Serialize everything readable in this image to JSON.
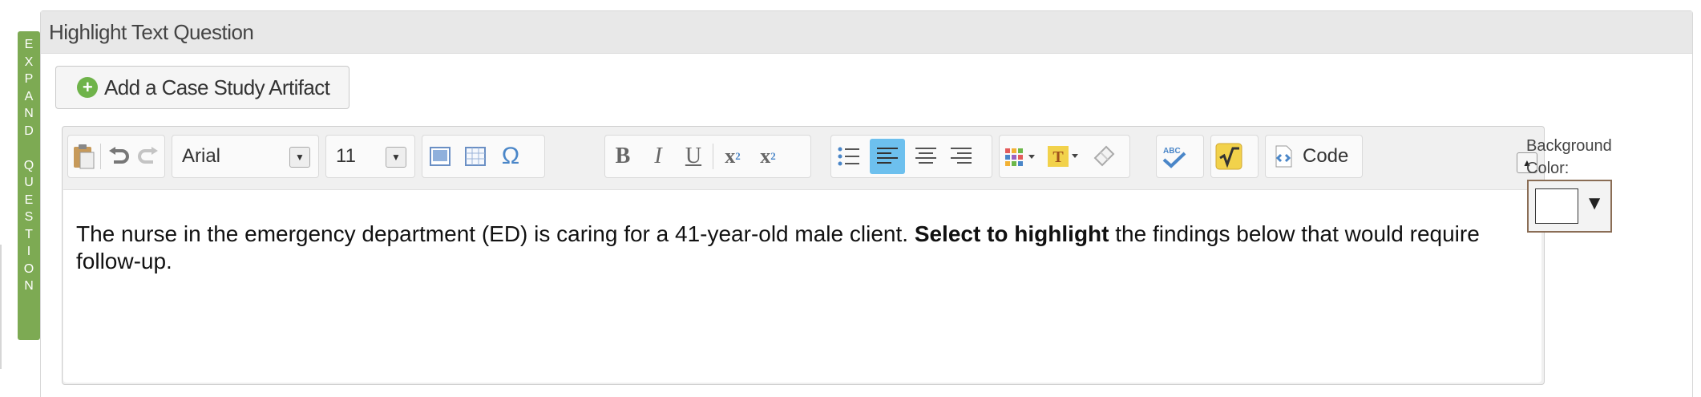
{
  "expand_tab": {
    "letters": [
      "E",
      "X",
      "P",
      "A",
      "N",
      "D",
      "",
      "Q",
      "U",
      "E",
      "S",
      "T",
      "I",
      "O",
      "N"
    ]
  },
  "panel": {
    "title": "Highlight Text Question"
  },
  "artifact_button": {
    "label": "Add a Case Study Artifact"
  },
  "toolbar": {
    "font_name": "Arial",
    "font_size": "11",
    "code_label": "Code"
  },
  "editor": {
    "text_before": "The nurse in the emergency department (ED) is caring for a 41-year-old male client. ",
    "text_bold": "Select to highlight",
    "text_after": " the findings below that would require follow-up."
  },
  "background_color": {
    "label": "Background Color:",
    "value": "#ffffff"
  },
  "colors": {
    "accent_green": "#7daa53",
    "active_button": "#6dc0ee",
    "icon_yellow": "#f2d24b"
  }
}
